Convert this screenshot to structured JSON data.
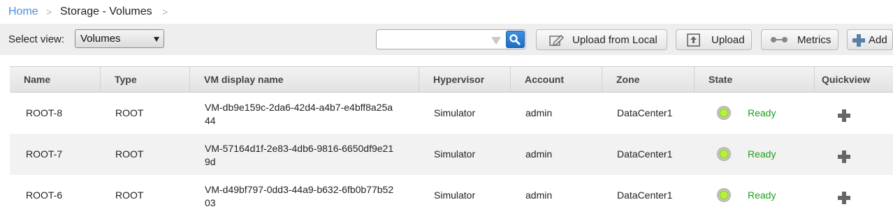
{
  "breadcrumb": {
    "home": "Home",
    "current": "Storage - Volumes"
  },
  "toolbar": {
    "select_label": "Select view:",
    "select_value": "Volumes",
    "search_placeholder": "",
    "buttons": {
      "upload_local": "Upload from Local",
      "upload": "Upload",
      "metrics": "Metrics",
      "add": "Add"
    }
  },
  "table": {
    "headers": [
      "Name",
      "Type",
      "VM display name",
      "Hypervisor",
      "Account",
      "Zone",
      "State",
      "Quickview"
    ],
    "rows": [
      {
        "name": "ROOT-8",
        "type": "ROOT",
        "vm_line1": "VM-db9e159c-2da6-42d4-a4b7-e4bff8a25a",
        "vm_line2": "44",
        "hypervisor": "Simulator",
        "account": "admin",
        "zone": "DataCenter1",
        "state": "Ready"
      },
      {
        "name": "ROOT-7",
        "type": "ROOT",
        "vm_line1": "VM-57164d1f-2e83-4db6-9816-6650df9e21",
        "vm_line2": "9d",
        "hypervisor": "Simulator",
        "account": "admin",
        "zone": "DataCenter1",
        "state": "Ready"
      },
      {
        "name": "ROOT-6",
        "type": "ROOT",
        "vm_line1": "VM-d49bf797-0dd3-44a9-b632-6fb0b77b52",
        "vm_line2": "03",
        "hypervisor": "Simulator",
        "account": "admin",
        "zone": "DataCenter1",
        "state": "Ready"
      }
    ]
  },
  "colors": {
    "link": "#4a90d9",
    "ready": "#1f9d1f",
    "search_button": "#2a7fd6"
  },
  "icons": {
    "search": "search-icon",
    "filter": "filter-arrow-icon",
    "upload_local": "edit-upload-icon",
    "upload": "upload-icon",
    "metrics": "metrics-icon",
    "add": "plus-icon",
    "quickview": "plus-icon",
    "state": "green-status-led-icon"
  }
}
